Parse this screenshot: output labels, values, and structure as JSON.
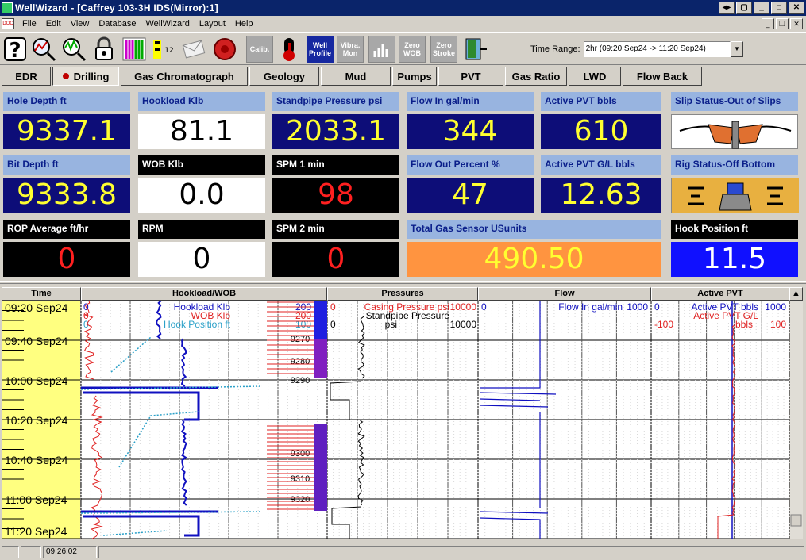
{
  "window": {
    "title": "WellWizard - [Caffrey 103-3H IDS(Mirror):1]"
  },
  "menu": [
    "File",
    "Edit",
    "View",
    "Database",
    "WellWizard",
    "Layout",
    "Help"
  ],
  "toolbar": {
    "calib_label": "Calib.",
    "well_profile_label": "Well Profile",
    "vibra_mon_label": "Vibra. Mon",
    "zero_wob_label": "Zero WOB",
    "zero_stroke_label": "Zero Stroke",
    "time_range_label": "Time Range:",
    "time_range_value": "2hr (09:20 Sep24 -> 11:20 Sep24)"
  },
  "tabs": [
    {
      "label": "EDR"
    },
    {
      "label": "Drilling"
    },
    {
      "label": "Gas Chromatograph"
    },
    {
      "label": "Geology"
    },
    {
      "label": "Mud"
    },
    {
      "label": "Pumps"
    },
    {
      "label": "PVT"
    },
    {
      "label": "Gas Ratio"
    },
    {
      "label": "LWD"
    },
    {
      "label": "Flow Back"
    }
  ],
  "panels": {
    "hole_depth": {
      "label": "Hole Depth ft",
      "value": "9337.1"
    },
    "hookload": {
      "label": "Hookload Klb",
      "value": "81.1"
    },
    "standpipe": {
      "label": "Standpipe Pressure psi",
      "value": "2033.1"
    },
    "flow_in": {
      "label": "Flow In gal/min",
      "value": "344"
    },
    "active_pvt": {
      "label": "Active PVT bbls",
      "value": "610"
    },
    "slip_status": {
      "label": "Slip Status-Out of Slips"
    },
    "bit_depth": {
      "label": "Bit Depth ft",
      "value": "9333.8"
    },
    "wob": {
      "label": "WOB Klb",
      "value": "0.0"
    },
    "spm1": {
      "label": "SPM 1 min",
      "value": "98"
    },
    "flow_out": {
      "label": "Flow Out Percent %",
      "value": "47"
    },
    "active_pvt_gl": {
      "label": "Active PVT G/L bbls",
      "value": "12.63"
    },
    "rig_status": {
      "label": "Rig Status-Off Bottom"
    },
    "rop": {
      "label": "ROP Average ft/hr",
      "value": "0"
    },
    "rpm": {
      "label": "RPM",
      "value": "0"
    },
    "spm2": {
      "label": "SPM 2 min",
      "value": "0"
    },
    "total_gas": {
      "label": "Total Gas Sensor USunits",
      "value": "490.50"
    },
    "hook_position": {
      "label": "Hook Position ft",
      "value": "11.5"
    }
  },
  "chart": {
    "headers": {
      "time": "Time",
      "hookload_wob": "Hookload/WOB",
      "pressures": "Pressures",
      "flow": "Flow",
      "active_pvt": "Active PVT"
    },
    "time_labels": [
      "09:20 Sep24",
      "09:40 Sep24",
      "10:00 Sep24",
      "10:20 Sep24",
      "10:40 Sep24",
      "11:00 Sep24",
      "11:20 Sep24"
    ],
    "hookload_track": {
      "series": [
        {
          "name": "Hookload Klb",
          "min": "0",
          "max": "200",
          "color": "#1010c0"
        },
        {
          "name": "WOB Klb",
          "min": "0",
          "max": "200",
          "color": "#e02020"
        },
        {
          "name": "Hook Position ft",
          "min": "0",
          "max": "100",
          "color": "#2aa0c8"
        }
      ],
      "depth_labels": [
        "9270",
        "9280",
        "9290",
        "9300",
        "9310",
        "9320"
      ]
    },
    "pressure_track": {
      "series": [
        {
          "name": "Casing Pressure psi",
          "min": "0",
          "max": "10000",
          "color": "#e02020"
        },
        {
          "name": "Standpipe Pressure",
          "unit": "psi",
          "min": "0",
          "max": "10000",
          "color": "#000000"
        }
      ]
    },
    "flow_track": {
      "series": [
        {
          "name": "Flow In gal/min",
          "min": "0",
          "max": "1000",
          "color": "#1010c0"
        }
      ]
    },
    "pvt_track": {
      "series": [
        {
          "name": "Active PVT bbls",
          "min": "0",
          "max": "1000",
          "color": "#1010c0"
        },
        {
          "name": "Active PVT G/L",
          "unit": "bbls",
          "min": "-100",
          "max": "100",
          "color": "#e02020"
        }
      ]
    }
  },
  "status": {
    "clock": "09:26:02"
  }
}
